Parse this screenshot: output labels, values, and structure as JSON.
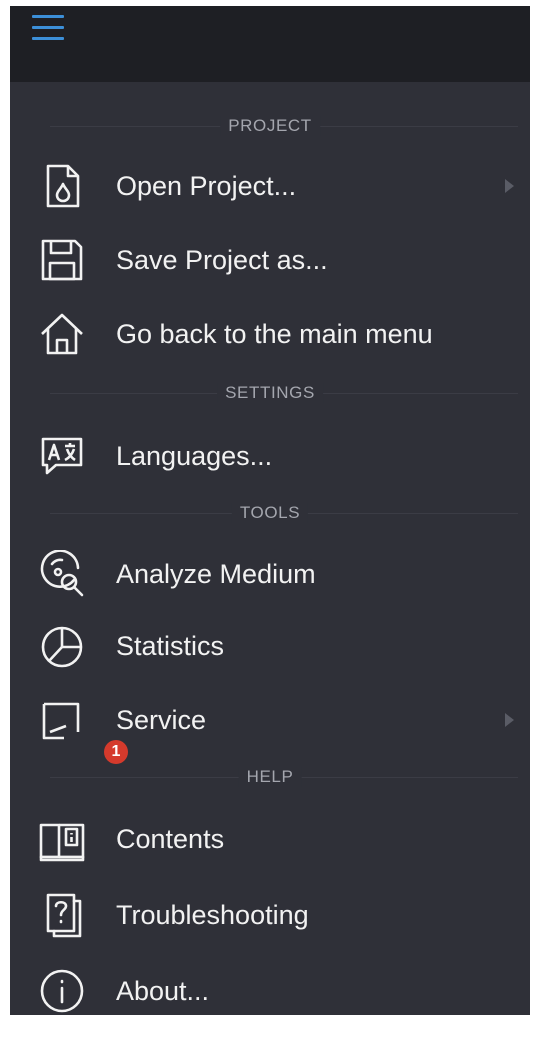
{
  "header": {
    "menu_icon": "hamburger-menu-icon",
    "accent_color": "#3c8fd8"
  },
  "sections": {
    "project": "PROJECT",
    "settings": "SETTINGS",
    "tools": "TOOLS",
    "help": "HELP"
  },
  "items": {
    "open_project": {
      "label": "Open Project...",
      "icon": "document-flame-icon",
      "has_submenu": true
    },
    "save_project": {
      "label": "Save Project as...",
      "icon": "floppy-disk-icon"
    },
    "main_menu": {
      "label": "Go back to the main menu",
      "icon": "home-icon"
    },
    "languages": {
      "label": "Languages...",
      "icon": "language-icon"
    },
    "analyze": {
      "label": "Analyze Medium",
      "icon": "disc-search-icon"
    },
    "statistics": {
      "label": "Statistics",
      "icon": "pie-chart-icon"
    },
    "service": {
      "label": "Service",
      "icon": "service-icon",
      "badge": "1",
      "has_submenu": true
    },
    "contents": {
      "label": "Contents",
      "icon": "book-info-icon"
    },
    "troubleshooting": {
      "label": "Troubleshooting",
      "icon": "help-pages-icon"
    },
    "about": {
      "label": "About...",
      "icon": "info-circle-icon"
    }
  },
  "colors": {
    "panel": "#2f3038",
    "topbar": "#1e1f24",
    "text": "#f2f2f2",
    "section_text": "#a4a6ae",
    "badge": "#d53a2c"
  }
}
